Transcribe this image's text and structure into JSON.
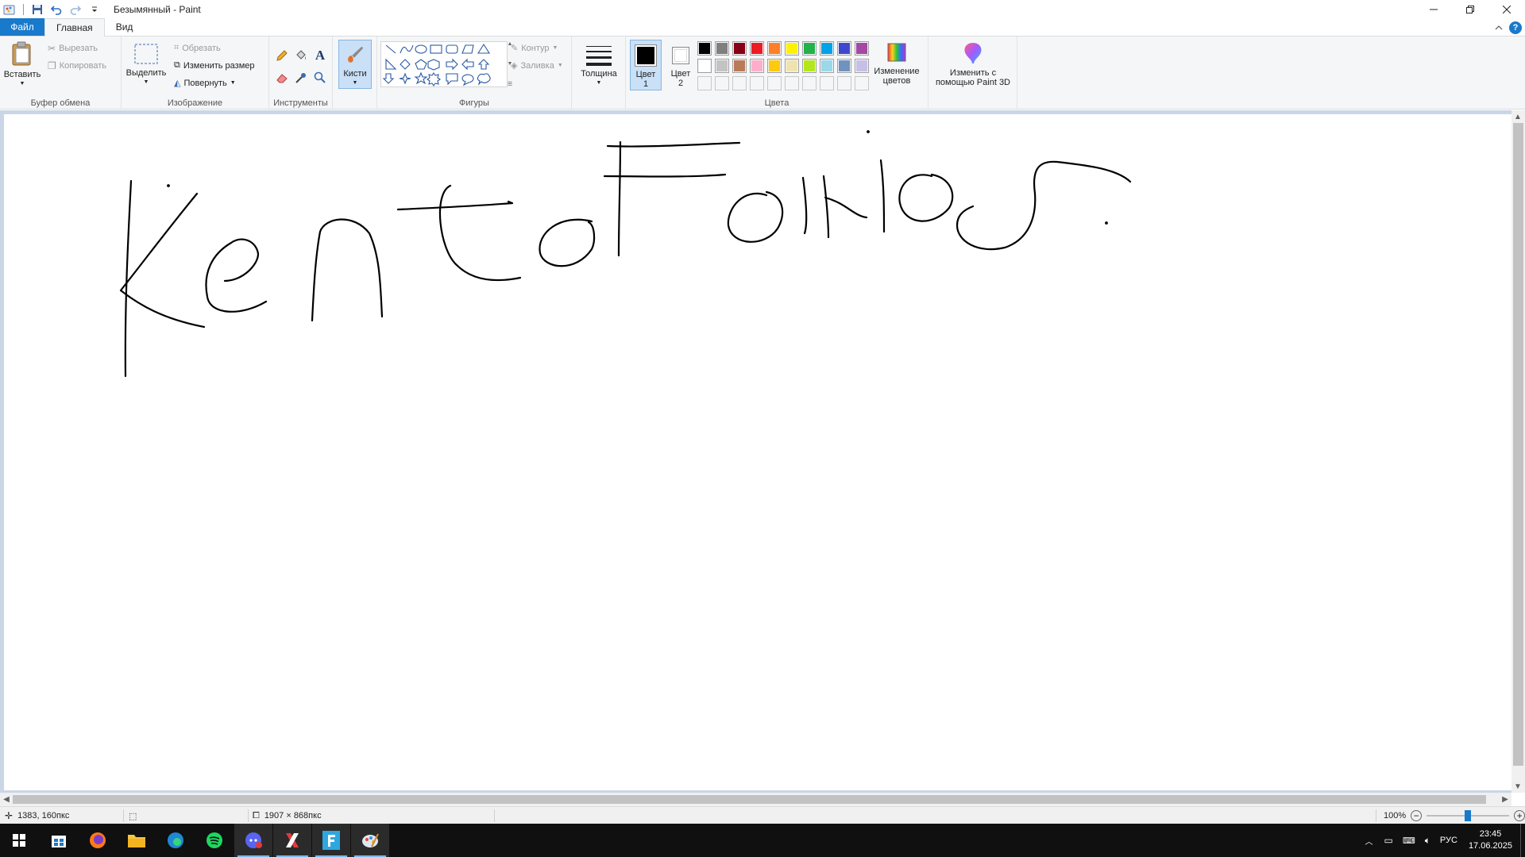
{
  "window": {
    "title": "Безымянный - Paint"
  },
  "tabs": [
    {
      "label": "Файл"
    },
    {
      "label": "Главная"
    },
    {
      "label": "Вид"
    }
  ],
  "ribbon": {
    "clipboard": {
      "label": "Буфер обмена",
      "paste": "Вставить",
      "cut": "Вырезать",
      "copy": "Копировать"
    },
    "image": {
      "label": "Изображение",
      "select": "Выделить",
      "crop": "Обрезать",
      "resize": "Изменить размер",
      "rotate": "Повернуть"
    },
    "tools": {
      "label": "Инструменты"
    },
    "brushes": {
      "label": "Кисти"
    },
    "shapes": {
      "label": "Фигуры",
      "outline": "Контур",
      "fill": "Заливка"
    },
    "size": {
      "label": "Толщина"
    },
    "colors": {
      "label": "Цвета",
      "color1": "Цвет 1",
      "color2": "Цвет 2",
      "edit": "Изменение цветов",
      "paint3d": "Изменить с помощью Paint 3D",
      "color1_value": "#000000",
      "color2_value": "#ffffff",
      "palette": [
        "#000000",
        "#7f7f7f",
        "#880015",
        "#ed1c24",
        "#ff7f27",
        "#fff200",
        "#22b14c",
        "#00a2e8",
        "#3f48cc",
        "#a349a4",
        "#ffffff",
        "#c3c3c3",
        "#b97a57",
        "#ffaec9",
        "#ffc90e",
        "#efe4b0",
        "#b5e61d",
        "#99d9ea",
        "#7092be",
        "#c8bfe7"
      ]
    }
  },
  "status": {
    "cursor_pos": "1383, 160пкс",
    "canvas_size": "1907 × 868пкс",
    "zoom": "100%",
    "zoom_level": 0.5
  },
  "taskbar": {
    "lang": "РУС",
    "time": "23:45",
    "date": "17.06.2025"
  }
}
